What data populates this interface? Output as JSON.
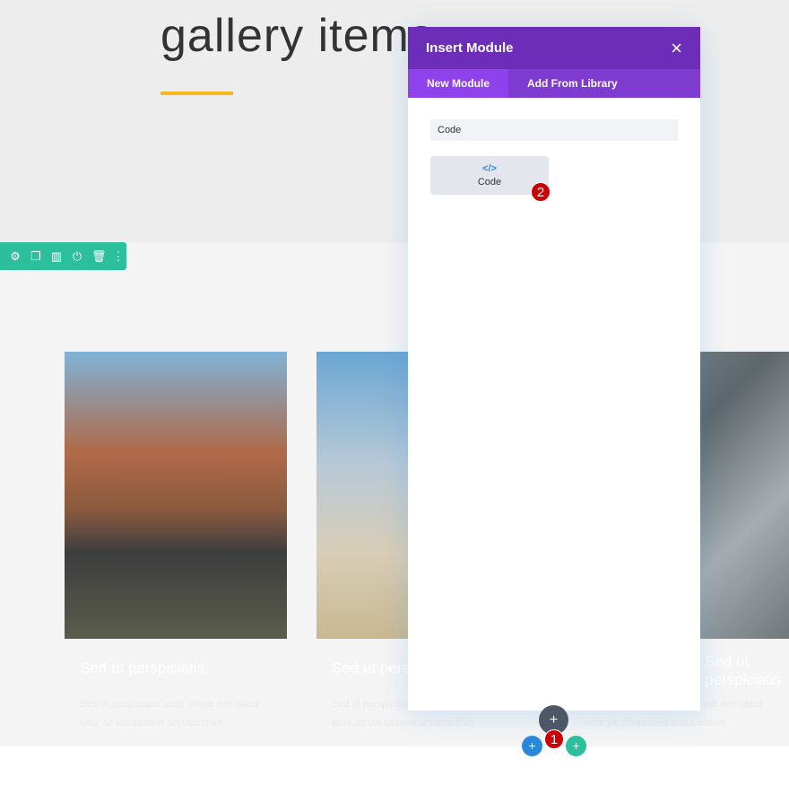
{
  "hero": {
    "title": "gallery items",
    "accent": "#f5b921"
  },
  "toolbar": {
    "icons": [
      "gear-icon",
      "duplicate-icon",
      "columns-icon",
      "power-icon",
      "trash-icon",
      "more-icon"
    ]
  },
  "cards": [
    {
      "title": "Sed ut perspiciatis",
      "text": "Sed ut perspiciatis unde omnis iste natus error sit voluptatem accusantium"
    },
    {
      "title": "Sed ut perspiciatis",
      "text": "Sed ut perspiciatis unde omnis iste natus error sit voluptatem accusantium"
    },
    {
      "title": "Sed ut perspiciatis",
      "text": "Sed ut perspiciatis unde omnis iste natus error sit voluptatem accusantium"
    }
  ],
  "modal": {
    "title": "Insert Module",
    "close": "×",
    "tabs": [
      "New Module",
      "Add From Library"
    ],
    "search_value": "Code",
    "module": {
      "icon": "</>",
      "label": "Code"
    }
  },
  "badges": [
    "1",
    "2"
  ],
  "buttons": {
    "add": "+"
  },
  "colors": {
    "purple": "#6c2eb9",
    "teal": "#2bbf9b",
    "blue": "#2b87da",
    "badge": "#cc0000"
  }
}
